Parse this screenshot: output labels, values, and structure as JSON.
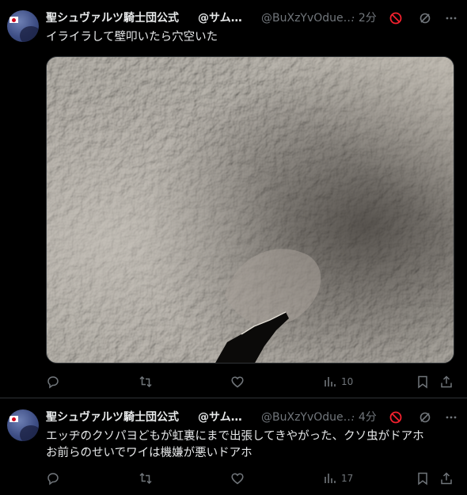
{
  "posts": [
    {
      "author_name": "聖シュヴァルツ騎士団公式",
      "author_name_extra": "@サム…",
      "handle": "@BuXzYvOdue…",
      "time": "· 2分",
      "text": "イライラして壁叩いたら穴空いた",
      "views": "10",
      "has_media": true
    },
    {
      "author_name": "聖シュヴァルツ騎士団公式",
      "author_name_extra": "@サム…",
      "handle": "@BuXzYvOdue…",
      "time": "· 4分",
      "text_line1": "エッヂのクソパヨどもが虹裏にまで出張してきやがった、クソ虫がドアホ",
      "text_line2": "お前らのせいでワイは機嫌が悪いドアホ",
      "views": "17",
      "has_media": false
    }
  ],
  "icons": {
    "reply": "reply-icon",
    "repost": "repost-icon",
    "like": "like-icon",
    "views": "views-icon",
    "bookmark": "bookmark-icon",
    "share": "share-icon",
    "block": "block-icon",
    "grok": "grok-icon",
    "more": "more-icon"
  },
  "colors": {
    "background": "#000000",
    "text": "#e7e9ea",
    "muted": "#71767b",
    "block_red": "#f4212e",
    "divider": "#2f3336"
  }
}
